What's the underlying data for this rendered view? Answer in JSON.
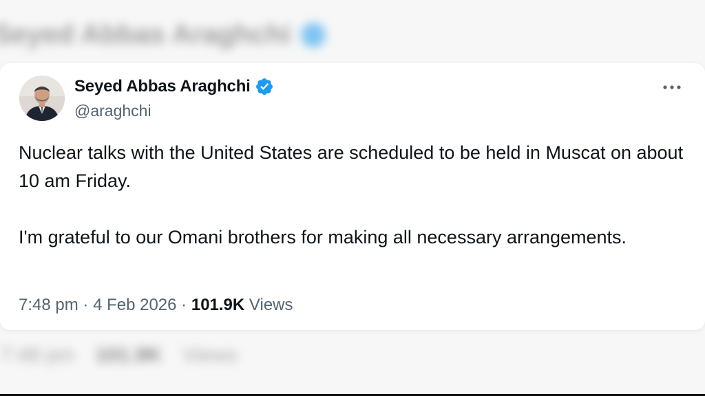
{
  "background": {
    "blurred_name": "Seyed Abbas Araghchi",
    "blurred_meta": {
      "time": "7:48 pm",
      "views_count": "101.9K",
      "views_label": "Views"
    }
  },
  "tweet": {
    "author": {
      "display_name": "Seyed Abbas Araghchi",
      "handle": "@araghchi",
      "verified": true
    },
    "paragraphs": [
      "Nuclear talks with the United States are scheduled to be held in Muscat on about 10 am Friday.",
      "I'm grateful to our Omani brothers for making all necessary arrangements."
    ],
    "time": "7:48 pm",
    "separator": "·",
    "date": "4 Feb 2026",
    "views_count": "101.9K",
    "views_label": "Views"
  },
  "icons": {
    "verified": "verified-badge-icon",
    "more": "more-options-icon"
  },
  "colors": {
    "verified_blue": "#1d9bf0",
    "text_primary": "#0f1419",
    "text_secondary": "#536471"
  }
}
